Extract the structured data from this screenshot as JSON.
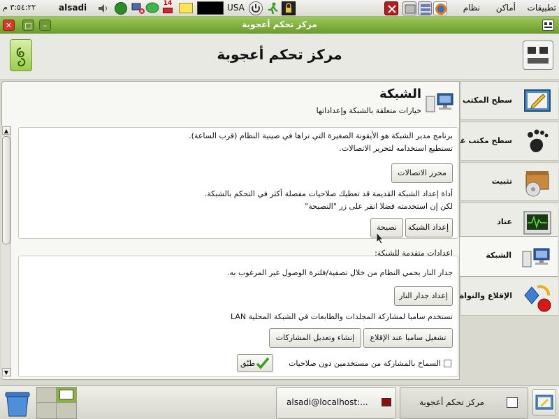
{
  "top_panel": {
    "menus": [
      "تطبيقات",
      "أماكن",
      "نظام"
    ],
    "clock": "٣:٥٤:٢٢ م",
    "user": "alsadi",
    "keyboard_layout": "USA",
    "notification_count": "14",
    "colors": {
      "panel_bg": "#e6e6df",
      "accent_red": "#c23030",
      "green": "#3a9a2a"
    }
  },
  "window": {
    "title": "مركز تحكم أعجوبة",
    "controls": {
      "close": "✕",
      "maximize": "□",
      "minimize": "–"
    }
  },
  "header": {
    "title": "مركز تحكم أعجوبة"
  },
  "sidebar": {
    "items": [
      {
        "label": "سطح المكتب",
        "icon": "desktop-pencil-icon"
      },
      {
        "label": "سطح مكتب غنوم",
        "icon": "gnome-foot-icon"
      },
      {
        "label": "تثبيت",
        "icon": "package-box-icon"
      },
      {
        "label": "عتاد",
        "icon": "hardware-monitor-icon"
      },
      {
        "label": "الشبكة",
        "icon": "network-computers-icon"
      },
      {
        "label": "الإقلاع والنواة",
        "icon": "boot-kernel-icon"
      }
    ],
    "selected": "الشبكة"
  },
  "section": {
    "title": "الشبكة",
    "subtitle": "خيارات متعلقة بالشبكة وإعداداتها",
    "icon": "network-computers-icon"
  },
  "network_box": {
    "text1_line1": "برنامج مدير الشبكة هو الأيقونة الصغيرة التي تراها في صينية النظام (قرب الساعة).",
    "text1_line2": "تستطيع استخدامه لتحرير الاتصالات.",
    "connections_editor_button": "محرر الاتصالات",
    "text2_line1": "أداة إعداد الشبكة القديمة قد تعطيك صلاحيات مفصلة أكثر في التحكم بالشبكة.",
    "text2_line2": "لكن إن استخدمته فضلا انقر على زر \"النصيحة\"",
    "network_setup_button": "إعداد الشبكة",
    "advice_button": "نصيحة"
  },
  "advanced": {
    "heading": "إعدادات متقدمة للشبكة:",
    "firewall_text": "جدار النار يحمي النظام من خلال تصفية/فلترة الوصول غير المرغوب به.",
    "firewall_button": "إعداد جدار النار",
    "samba_text": "تستخدم سامبا لمشاركة المجلدات والطابعات في الشبكة المحلية LAN",
    "samba_boot_button": "تشغيل سامبا عند الإقلاع",
    "shares_button": "إنشاء وتعديل المشاركات",
    "guest_checkbox_label": "السماح بالمشاركة من مستخدمين دون صلاحيات",
    "guest_checkbox_checked": false,
    "apply_button": "طبّق"
  },
  "bottom_panel": {
    "tasks": [
      {
        "label": "مركز تحكم أعجوبة",
        "icon": "control-center-icon",
        "active": true
      },
      {
        "label": "alsadi@localhost:...",
        "icon": "terminal-icon",
        "active": false
      }
    ],
    "workspaces": 4
  }
}
